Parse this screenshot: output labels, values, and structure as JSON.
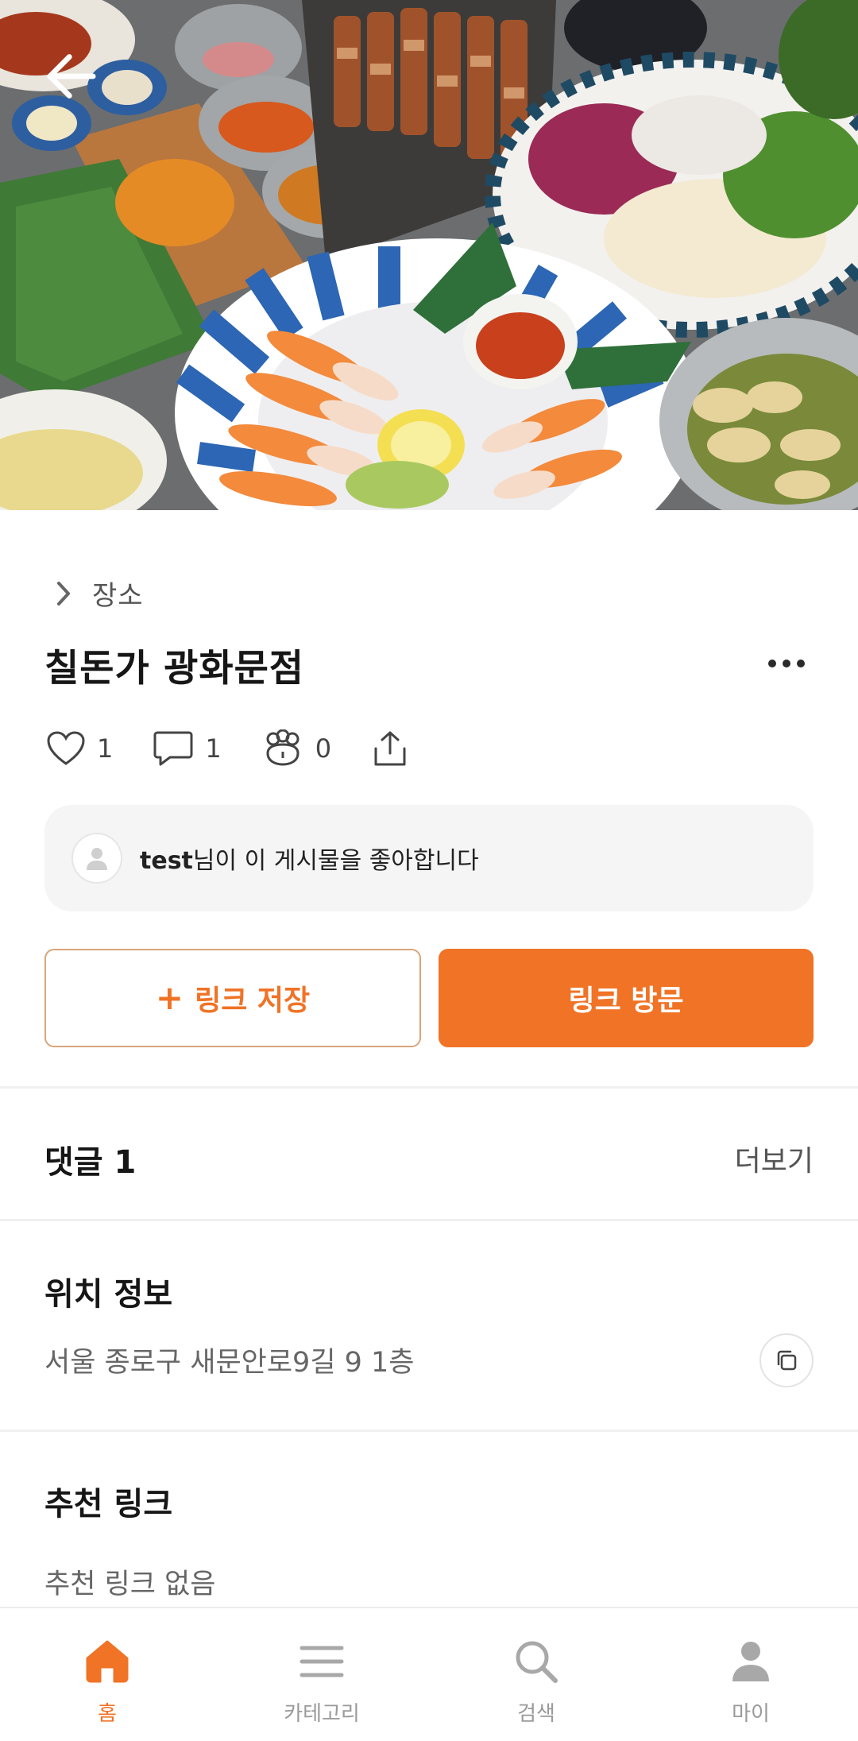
{
  "header": {
    "back_icon": "arrow-left-icon"
  },
  "place": {
    "breadcrumb": "장소",
    "title": "칠돈가 광화문점"
  },
  "stats": {
    "likes": "1",
    "comments": "1",
    "visits": "0"
  },
  "liked_by": {
    "user": "test",
    "suffix": "님이 이 게시물을 좋아합니다"
  },
  "actions": {
    "save_plus": "+",
    "save_label": "링크 저장",
    "visit_label": "링크 방문"
  },
  "comments_section": {
    "title": "댓글 1",
    "more": "더보기"
  },
  "location_section": {
    "title": "위치 정보",
    "address": "서울 종로구 새문안로9길 9 1층"
  },
  "recommend_section": {
    "title": "추천 링크",
    "empty": "추천 링크 없음"
  },
  "nav": [
    {
      "label": "홈",
      "icon": "home-icon",
      "active": true
    },
    {
      "label": "카테고리",
      "icon": "menu-icon",
      "active": false
    },
    {
      "label": "검색",
      "icon": "search-icon",
      "active": false
    },
    {
      "label": "마이",
      "icon": "user-icon",
      "active": false
    }
  ],
  "colors": {
    "accent": "#f07326",
    "accent_border": "#d9a57a",
    "muted_text": "#666666"
  }
}
